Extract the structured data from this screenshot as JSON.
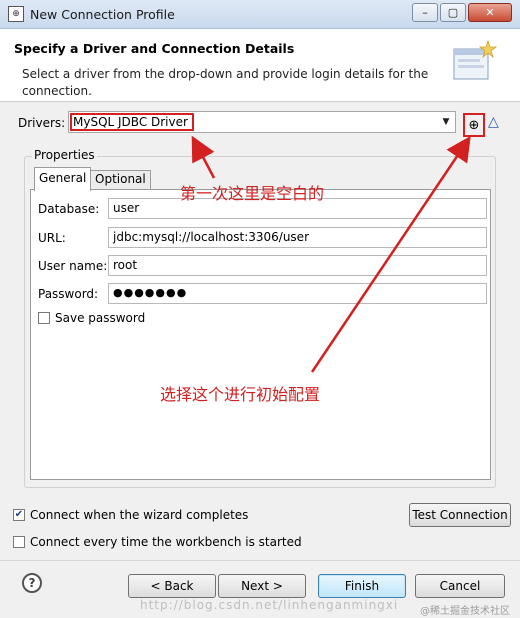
{
  "window": {
    "title": "New Connection Profile",
    "controls": {
      "minimize": "–",
      "maximize": "▢",
      "close": "✕"
    }
  },
  "banner": {
    "title": "Specify a Driver and Connection Details",
    "description": "Select a driver from the drop-down and provide login details for the connection."
  },
  "drivers": {
    "label": "Drivers:",
    "selected": "MySQL JDBC Driver",
    "new_driver_icon": "new-driver-icon",
    "edit_driver_icon": "warning-triangle-icon"
  },
  "properties": {
    "group_label": "Properties",
    "tabs": [
      {
        "label": "General",
        "active": true
      },
      {
        "label": "Optional",
        "active": false
      }
    ],
    "fields": [
      {
        "label": "Database:",
        "value": "user"
      },
      {
        "label": "URL:",
        "value": "jdbc:mysql://localhost:3306/user"
      },
      {
        "label": "User name:",
        "value": "root"
      },
      {
        "label": "Password:",
        "value": "●●●●●●●"
      }
    ],
    "save_password": {
      "label": "Save password",
      "checked": false
    }
  },
  "annotations": {
    "first_time_blank": "第一次这里是空白的",
    "select_to_init": "选择这个进行初始配置",
    "color": "#d32020"
  },
  "options": {
    "connect_on_finish": {
      "label": "Connect when the wizard completes",
      "checked": true
    },
    "connect_on_startup": {
      "label": "Connect every time the workbench is started",
      "checked": false
    }
  },
  "buttons": {
    "test_connection": "Test Connection",
    "back": "< Back",
    "next": "Next >",
    "finish": "Finish",
    "cancel": "Cancel"
  },
  "watermark": {
    "url": "http://blog.csdn.net/linhenganmingxi",
    "tag": "@稀土掘金技术社区"
  }
}
